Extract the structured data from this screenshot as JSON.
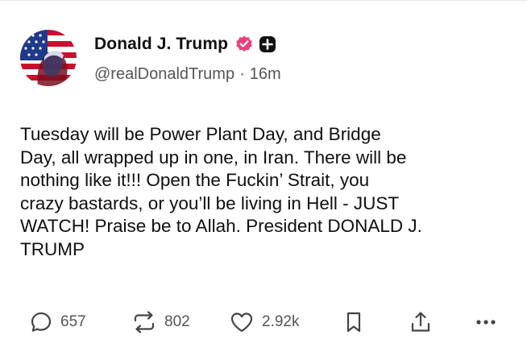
{
  "post": {
    "author": {
      "display_name": "Donald J. Trump",
      "handle": "@realDonaldTrump",
      "separator": "·",
      "time_ago": "16m",
      "avatar_icon": "flag-portrait-avatar",
      "verified_icon": "verified-badge-icon",
      "verified_color": "#e8417e",
      "plus_icon": "plus-badge-icon"
    },
    "text": "Tuesday will be Power Plant Day, and Bridge\nDay, all wrapped up in one, in Iran. There will be\nnothing like it!!! Open the Fuckin’ Strait, you\ncrazy bastards, or you’ll be living in Hell - JUST\nWATCH! Praise be to Allah. President DONALD J.\nTRUMP"
  },
  "actions": {
    "reply": {
      "icon": "reply-icon",
      "count": "657"
    },
    "repost": {
      "icon": "repost-icon",
      "count": "802"
    },
    "like": {
      "icon": "heart-icon",
      "count": "2.92k"
    },
    "bookmark": {
      "icon": "bookmark-icon"
    },
    "share": {
      "icon": "share-icon"
    },
    "more": {
      "icon": "more-icon"
    }
  }
}
